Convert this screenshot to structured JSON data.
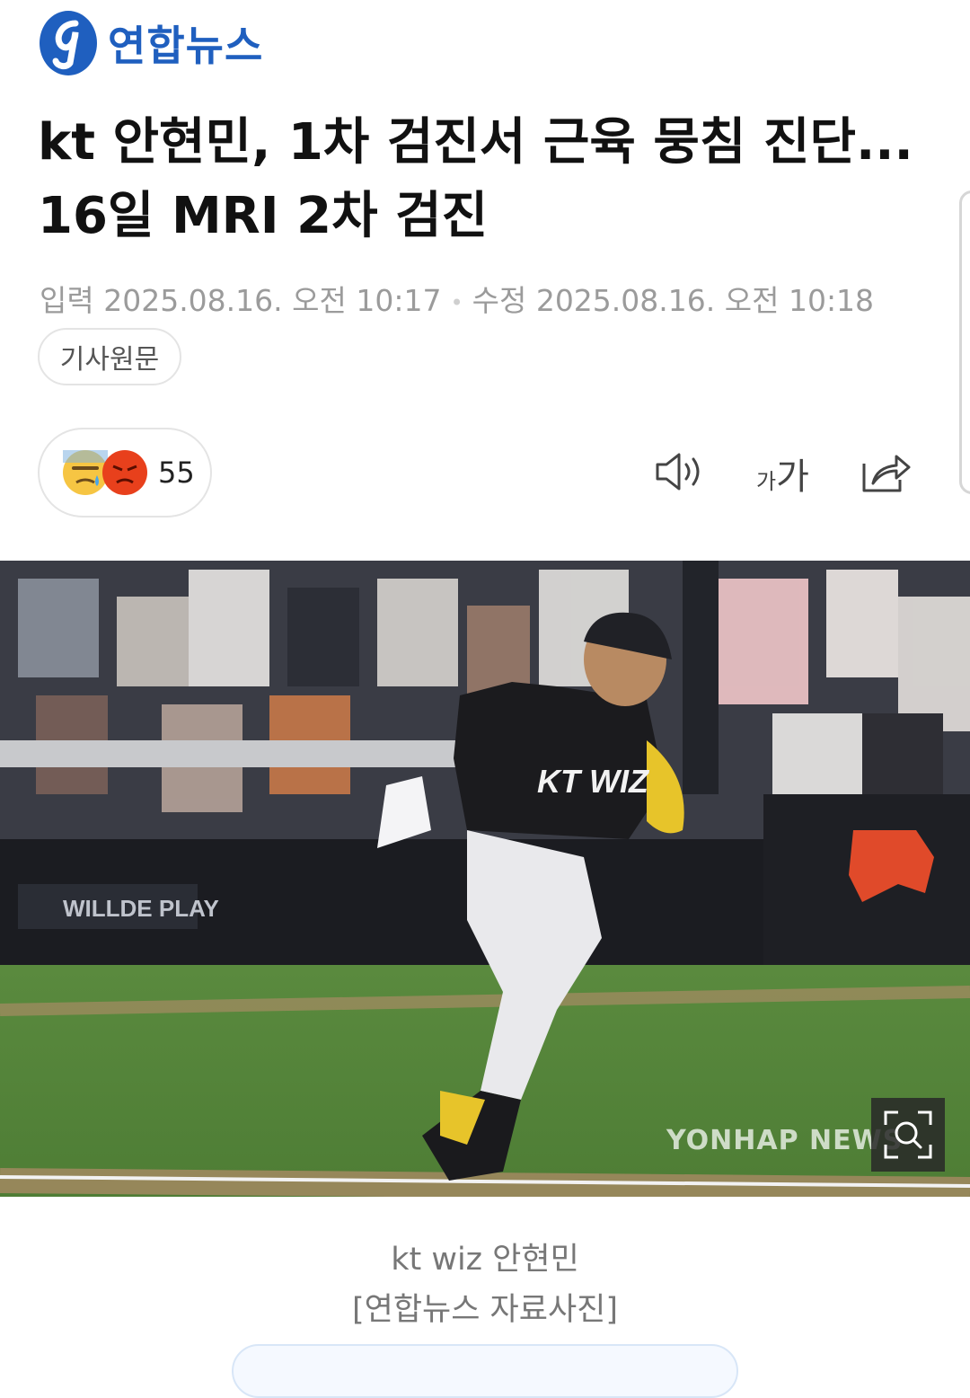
{
  "brand": {
    "name": "연합뉴스",
    "logo_icon": "yonhap-logo-icon",
    "color": "#1f5fbf"
  },
  "article": {
    "title_line1": "kt 안현민, 1차 검진서 근육 뭉침 진단...",
    "title_line2": "16일 MRI 2차 검진",
    "published": "입력 2025.08.16. 오전 10:17",
    "modified": "수정 2025.08.16. 오전 10:18",
    "source_button": "기사원문"
  },
  "reactions": {
    "icons": [
      "sad-tear-emoji",
      "angry-emoji"
    ],
    "count": "55"
  },
  "toolbar": {
    "tts_icon": "speaker-icon",
    "font_size_label": "가가",
    "share_icon": "share-icon"
  },
  "photo": {
    "watermark": "YONHAP NEWS",
    "zoom_icon": "zoom-icon",
    "caption_line1": "kt wiz 안현민",
    "caption_line2": "[연합뉴스 자료사진]"
  }
}
